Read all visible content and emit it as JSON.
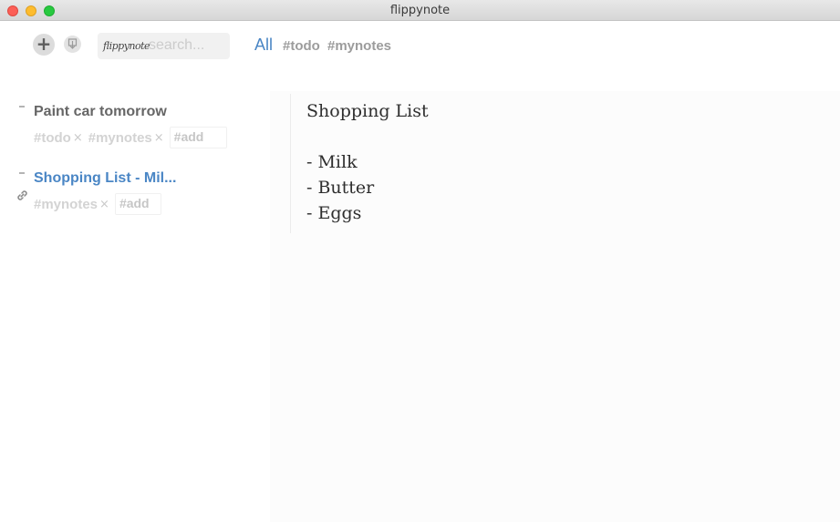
{
  "window": {
    "title": "flippynote"
  },
  "toolbar": {
    "add_label": "+",
    "logo_text": "flippynote",
    "search_placeholder": "search...",
    "search_value": "",
    "filters": [
      {
        "label": "All",
        "active": true
      },
      {
        "label": "#todo",
        "active": false
      },
      {
        "label": "#mynotes",
        "active": false
      }
    ]
  },
  "notes": [
    {
      "title": "Paint car tomorrow",
      "active": false,
      "tags": [
        "#todo",
        "#mynotes"
      ],
      "add_placeholder": "#add"
    },
    {
      "title": "Shopping List - Mil...",
      "active": true,
      "tags": [
        "#mynotes"
      ],
      "add_placeholder": "#add",
      "icon": "link-icon"
    }
  ],
  "editor": {
    "lines": [
      "Shopping List",
      "",
      "- Milk",
      "- Butter",
      "- Eggs"
    ]
  },
  "colors": {
    "accent": "#4a86c5",
    "title_text": "#666666",
    "tag_text": "#d3d3d3"
  },
  "remove_glyph": "×"
}
